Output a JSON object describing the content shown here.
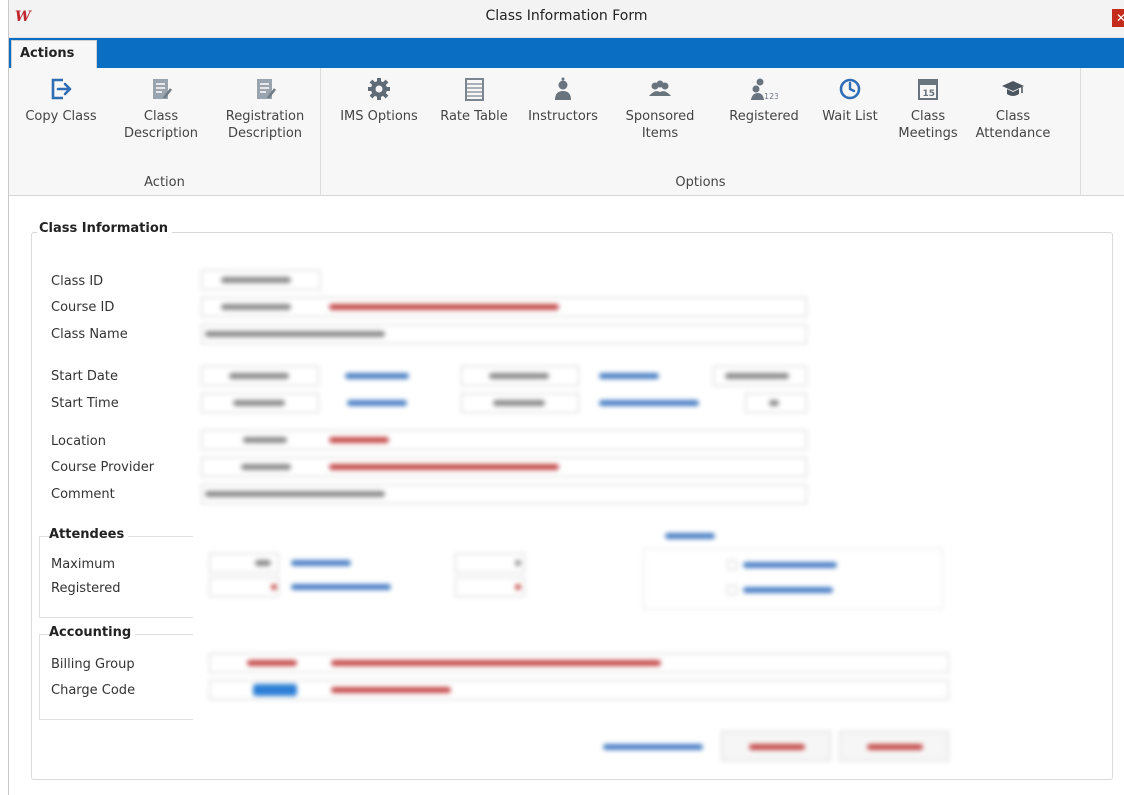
{
  "window": {
    "title": "Class Information Form",
    "close_label": "✕"
  },
  "ribbon": {
    "tab": "Actions",
    "groups": {
      "action": "Action",
      "options": "Options"
    },
    "buttons": {
      "copy_class": "Copy Class",
      "class_description": "Class\nDescription",
      "registration_description": "Registration\nDescription",
      "ims_options": "IMS Options",
      "rate_table": "Rate Table",
      "instructors": "Instructors",
      "sponsored_items": "Sponsored\nItems",
      "registered": "Registered",
      "wait_list": "Wait List",
      "class_meetings": "Class\nMeetings",
      "class_attendance": "Class\nAttendance"
    },
    "icon_color": "#2f6db5"
  },
  "form": {
    "section": "Class Information",
    "labels": {
      "class_id": "Class ID",
      "course_id": "Course ID",
      "class_name": "Class Name",
      "start_date": "Start Date",
      "start_time": "Start Time",
      "location": "Location",
      "course_provider": "Course Provider",
      "comment": "Comment"
    },
    "attendees": {
      "title": "Attendees",
      "maximum": "Maximum",
      "registered": "Registered"
    },
    "accounting": {
      "title": "Accounting",
      "billing_group": "Billing Group",
      "charge_code": "Charge Code"
    }
  }
}
